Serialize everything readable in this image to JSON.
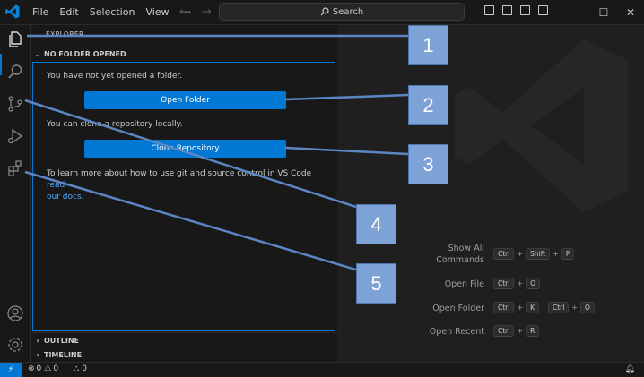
{
  "menu": {
    "file": "File",
    "edit": "Edit",
    "selection": "Selection",
    "view": "View",
    "more": "···"
  },
  "nav": {
    "back": "←",
    "forward": "→"
  },
  "search": {
    "placeholder": "Search"
  },
  "window": {
    "minimize": "—",
    "maximize": "☐",
    "close": "✕"
  },
  "sidebar": {
    "title": "EXPLORER",
    "section": "NO FOLDER OPENED",
    "msg1": "You have not yet opened a folder.",
    "open_folder": "Open Folder",
    "msg2": "You can clone a repository locally.",
    "clone_repo": "Clone Repository",
    "msg3": "To learn more about how to use git and source control in VS Code ",
    "msg3_link1": "read",
    "msg3_link2": "our docs",
    "msg3_end": ".",
    "outline": "OUTLINE",
    "timeline": "TIMELINE"
  },
  "shortcuts": [
    {
      "label": "Show All Commands",
      "keys": [
        "Ctrl",
        "Shift",
        "P"
      ]
    },
    {
      "label": "Open File",
      "keys": [
        "Ctrl",
        "O"
      ]
    },
    {
      "label": "Open Folder",
      "keys": [
        "Ctrl",
        "K",
        "Ctrl",
        "O"
      ]
    },
    {
      "label": "Open Recent",
      "keys": [
        "Ctrl",
        "R"
      ]
    }
  ],
  "status": {
    "remote": "⚡",
    "errors": "0",
    "warnings": "0",
    "ports": "0"
  },
  "callouts": [
    "1",
    "2",
    "3",
    "4",
    "5"
  ],
  "colors": {
    "accent": "#0078d4",
    "callout": "#7ca2d6"
  }
}
